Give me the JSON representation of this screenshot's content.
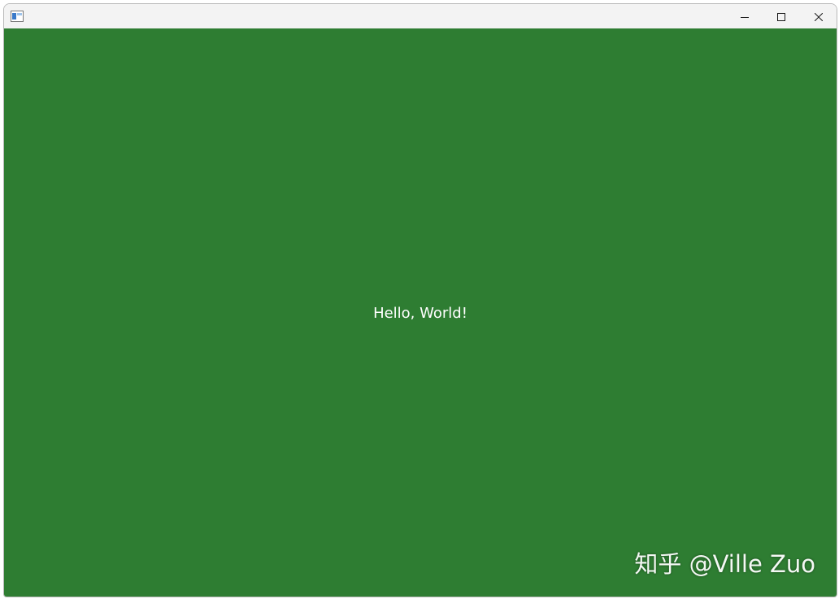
{
  "window": {
    "title": "",
    "icon": "app-window-icon",
    "controls": {
      "minimize_icon": "minimize-icon",
      "maximize_icon": "maximize-icon",
      "close_icon": "close-icon"
    }
  },
  "content": {
    "background_color": "#2e7d32",
    "message": "Hello, World!"
  },
  "watermark": {
    "text": "知乎 @Ville Zuo"
  }
}
